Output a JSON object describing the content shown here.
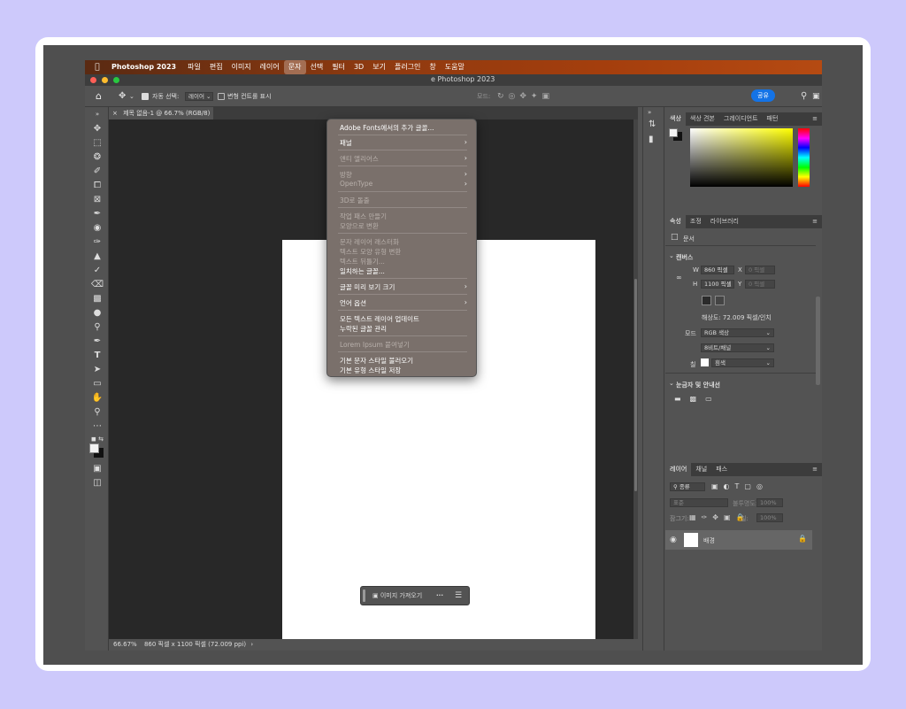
{
  "menubar": {
    "app_name": "Photoshop 2023",
    "items": [
      "파일",
      "편집",
      "이미지",
      "레이어",
      "문자",
      "선택",
      "필터",
      "3D",
      "보기",
      "플러그인",
      "창",
      "도움말"
    ],
    "active": "문자"
  },
  "titlebar": {
    "title": "e Photoshop 2023"
  },
  "options": {
    "auto_select_label": "자동 선택:",
    "layer_select": "레이어",
    "transform_label": "변형 컨트롤 표시",
    "mode_label": "모드:",
    "share_label": "공유"
  },
  "tab": {
    "close": "×",
    "title": "제목 없음-1 @ 66.7% (RGB/8)"
  },
  "text_menu": {
    "items": [
      {
        "label": "Adobe Fonts에서의 추가 글꼴...",
        "disabled": false,
        "submenu": false
      },
      {
        "label": "패널",
        "disabled": false,
        "submenu": true
      },
      {
        "label": "앤티 앨리어스",
        "disabled": true,
        "submenu": true
      },
      {
        "label": "방향",
        "disabled": true,
        "submenu": true
      },
      {
        "label": "OpenType",
        "disabled": true,
        "submenu": true
      },
      {
        "label": "3D로 돌출",
        "disabled": true,
        "submenu": false
      },
      {
        "label": "작업 패스 만들기",
        "disabled": true,
        "submenu": false
      },
      {
        "label": "모양으로 변환",
        "disabled": true,
        "submenu": false
      },
      {
        "label": "문자 레이어 래스터화",
        "disabled": true,
        "submenu": false
      },
      {
        "label": "텍스트 모양 유형 변환",
        "disabled": true,
        "submenu": false
      },
      {
        "label": "텍스트 뒤틀기...",
        "disabled": true,
        "submenu": false
      },
      {
        "label": "일치하는 글꼴...",
        "disabled": false,
        "submenu": false
      },
      {
        "label": "글꼴 미리 보기 크기",
        "disabled": false,
        "submenu": true
      },
      {
        "label": "언어 옵션",
        "disabled": false,
        "submenu": true
      },
      {
        "label": "모든 텍스트 레이어 업데이트",
        "disabled": false,
        "submenu": false
      },
      {
        "label": "누락된 글꼴 관리",
        "disabled": false,
        "submenu": false
      },
      {
        "label": "Lorem Ipsum 붙여넣기",
        "disabled": true,
        "submenu": false
      },
      {
        "label": "기본 문자 스타일 불러오기",
        "disabled": false,
        "submenu": false
      },
      {
        "label": "기본 유형 스타일 저장",
        "disabled": false,
        "submenu": false
      }
    ]
  },
  "context_bar": {
    "import_label": "이미지 가져오기",
    "more": "···"
  },
  "status": {
    "zoom": "66.67%",
    "info": "860 픽셀 x 1100 픽셀 (72.009 ppi)",
    "arrow": "›"
  },
  "color_panel": {
    "tabs": [
      "색상",
      "색상 견본",
      "그레이디언트",
      "패턴"
    ],
    "active_tab": "색상"
  },
  "properties_panel": {
    "tabs": [
      "속성",
      "조정",
      "라이브러리"
    ],
    "active_tab": "속성",
    "doc_label": "문서",
    "canvas_label": "캔버스",
    "w_label": "W",
    "w_value": "860 픽셀",
    "x_label": "X",
    "x_placeholder": "0 픽셀",
    "h_label": "H",
    "h_value": "1100 픽셀",
    "y_label": "Y",
    "y_placeholder": "0 픽셀",
    "resolution": "해상도: 72.009 픽셀/인치",
    "mode_label": "모드",
    "mode_value": "RGB 색상",
    "bit_value": "8비트/채널",
    "fill_label": "칠",
    "fill_value": "흰색",
    "rulers_label": "눈금자 및 안내선"
  },
  "layers_panel": {
    "tabs": [
      "레이어",
      "채널",
      "패스"
    ],
    "active_tab": "레이어",
    "kind_label": "종류",
    "blend_value": "표준",
    "opacity_label": "불투명도:",
    "opacity_value": "100%",
    "lock_label": "잠그기:",
    "fill_label": "칠:",
    "fill_value": "100%",
    "layer_name": "배경"
  },
  "colors": {
    "accent": "#1473e6",
    "menubar_start": "#5a2a12",
    "menubar_end": "#b54a12",
    "panel": "#535353",
    "canvas_bg": "#282828"
  }
}
